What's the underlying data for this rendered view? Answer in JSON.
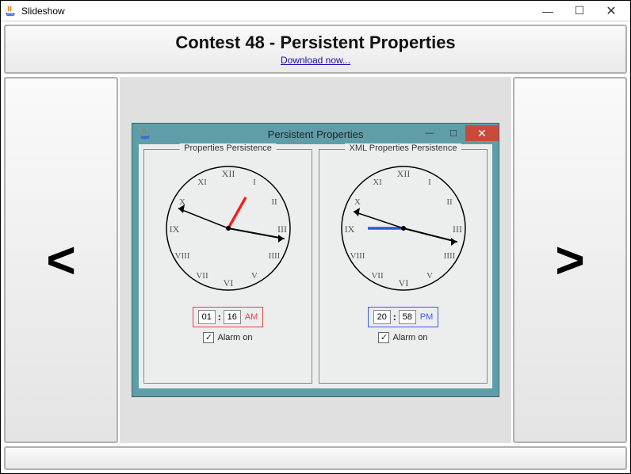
{
  "window": {
    "title": "Slideshow",
    "min": "—",
    "max": "☐",
    "close": "✕"
  },
  "header": {
    "title": "Contest 48 - Persistent Properties",
    "download": "Download now..."
  },
  "nav": {
    "prev": "<",
    "next": ">"
  },
  "inner": {
    "title": "Persistent Properties",
    "min": "—",
    "max": "☐",
    "close": "✕"
  },
  "panels": [
    {
      "legend": "Properties Persistence",
      "hour": "01",
      "minute": "16",
      "ampm": "AM",
      "alarm": "Alarm on",
      "checkmark": "✓"
    },
    {
      "legend": "XML Properties Persistence",
      "hour": "20",
      "minute": "58",
      "ampm": "PM",
      "alarm": "Alarm on",
      "checkmark": "✓"
    }
  ]
}
